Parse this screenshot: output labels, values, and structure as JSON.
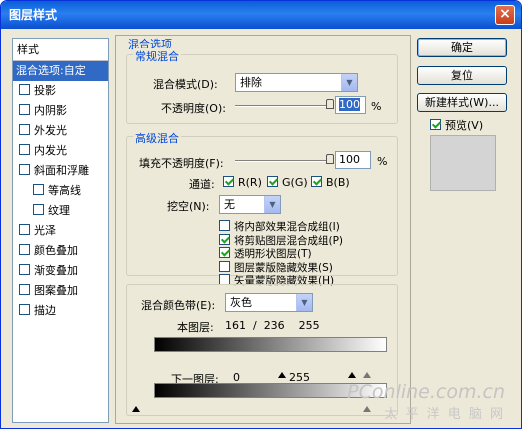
{
  "window": {
    "title": "图层样式",
    "close_label": "×"
  },
  "sidebar": {
    "header": "样式",
    "items": [
      {
        "label": "混合选项:自定",
        "checkbox": false,
        "selected": true,
        "sub": false,
        "checked": false
      },
      {
        "label": "投影",
        "checkbox": true,
        "selected": false,
        "sub": false,
        "checked": false
      },
      {
        "label": "内阴影",
        "checkbox": true,
        "selected": false,
        "sub": false,
        "checked": false
      },
      {
        "label": "外发光",
        "checkbox": true,
        "selected": false,
        "sub": false,
        "checked": false
      },
      {
        "label": "内发光",
        "checkbox": true,
        "selected": false,
        "sub": false,
        "checked": false
      },
      {
        "label": "斜面和浮雕",
        "checkbox": true,
        "selected": false,
        "sub": false,
        "checked": false
      },
      {
        "label": "等高线",
        "checkbox": true,
        "selected": false,
        "sub": true,
        "checked": false
      },
      {
        "label": "纹理",
        "checkbox": true,
        "selected": false,
        "sub": true,
        "checked": false
      },
      {
        "label": "光泽",
        "checkbox": true,
        "selected": false,
        "sub": false,
        "checked": false
      },
      {
        "label": "颜色叠加",
        "checkbox": true,
        "selected": false,
        "sub": false,
        "checked": false
      },
      {
        "label": "渐变叠加",
        "checkbox": true,
        "selected": false,
        "sub": false,
        "checked": false
      },
      {
        "label": "图案叠加",
        "checkbox": true,
        "selected": false,
        "sub": false,
        "checked": false
      },
      {
        "label": "描边",
        "checkbox": true,
        "selected": false,
        "sub": false,
        "checked": false
      }
    ]
  },
  "blending_options": {
    "title": "混合选项",
    "general": {
      "title": "常规混合",
      "blend_mode_label": "混合模式(D):",
      "blend_mode_value": "排除",
      "opacity_label": "不透明度(O):",
      "opacity_value": "100",
      "opacity_unit": "%",
      "opacity_level": 1.0
    },
    "advanced": {
      "title": "高级混合",
      "fill_opacity_label": "填充不透明度(F):",
      "fill_opacity_value": "100",
      "fill_opacity_unit": "%",
      "fill_level": 1.0,
      "channels_label": "通道:",
      "channels": [
        {
          "label": "R(R)",
          "checked": true
        },
        {
          "label": "G(G)",
          "checked": true
        },
        {
          "label": "B(B)",
          "checked": true
        }
      ],
      "knockout_label": "挖空(N):",
      "knockout_value": "无",
      "options": [
        {
          "label": "将内部效果混合成组(I)",
          "checked": false
        },
        {
          "label": "将剪贴图层混合成组(P)",
          "checked": true
        },
        {
          "label": "透明形状图层(T)",
          "checked": true
        },
        {
          "label": "图层蒙版隐藏效果(S)",
          "checked": false
        },
        {
          "label": "矢量蒙版隐藏效果(H)",
          "checked": false
        }
      ]
    },
    "blend_if": {
      "label": "混合颜色带(E):",
      "value": "灰色",
      "this_layer_label": "本图层:",
      "this_layer_values": "161  /  236    255",
      "underlying_label": "下一图层:",
      "underlying_low": "0",
      "underlying_high": "255"
    }
  },
  "buttons": {
    "ok": "确定",
    "reset": "复位",
    "new_style": "新建样式(W)...",
    "preview_label": "预览(V)",
    "preview_checked": true
  },
  "watermark": {
    "line1": "PConline.com.cn",
    "line2": "太 平 洋 电 脑 网"
  }
}
